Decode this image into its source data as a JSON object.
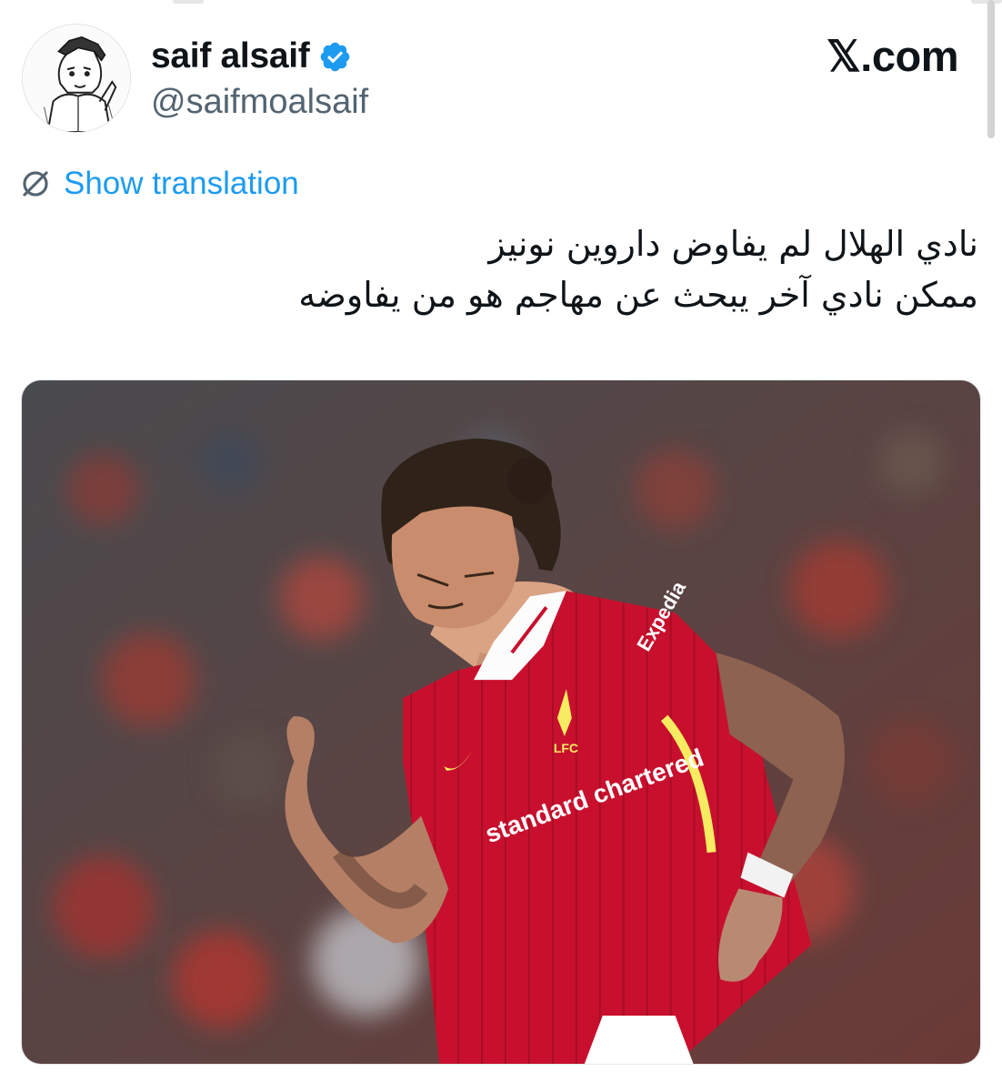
{
  "brand": {
    "label": "𝕏.com"
  },
  "author": {
    "display_name": "saif alsaif",
    "handle": "@saifmoalsaif"
  },
  "tweet": {
    "translate_label": "Show translation",
    "text_line_1": "نادي الهلال لم يفاوض داروين نونيز",
    "text_line_2": "ممكن نادي آخر يبحث عن مهاجم هو من يفاوضه"
  },
  "media": {
    "sponsor": "standard chartered",
    "sleeve_sponsor": "Expedia",
    "crest": "LFC"
  },
  "colors": {
    "accent": "#1d9bf0",
    "text": "#0f1419",
    "secondary_text": "#536471",
    "jersey_red": "#c8102e",
    "kit_trim": "#f6eb61"
  },
  "icons": {
    "verified": "verified-badge-icon",
    "translate": "globe-strike-icon"
  }
}
